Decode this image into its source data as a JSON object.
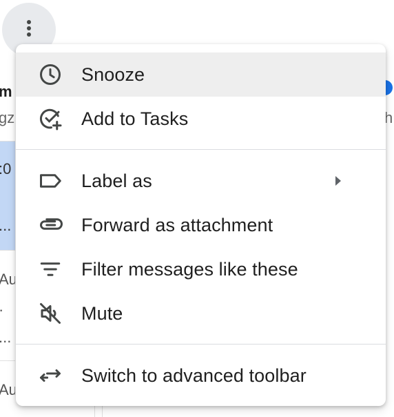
{
  "more_button": {
    "icon": "more-vert-icon"
  },
  "menu": {
    "groups": [
      {
        "items": [
          {
            "label": "Snooze",
            "icon": "clock-icon",
            "hovered": true
          },
          {
            "label": "Add to Tasks",
            "icon": "add-task-icon"
          }
        ]
      },
      {
        "items": [
          {
            "label": "Label as",
            "icon": "label-icon",
            "has_submenu": true
          },
          {
            "label": "Forward as attachment",
            "icon": "attachment-icon"
          },
          {
            "label": "Filter messages like these",
            "icon": "filter-icon"
          },
          {
            "label": "Mute",
            "icon": "mute-icon"
          }
        ]
      },
      {
        "items": [
          {
            "label": "Switch to advanced toolbar",
            "icon": "swap-arrows-icon"
          }
        ]
      }
    ]
  },
  "background": {
    "rows": [
      {
        "line1": "m",
        "line2": "gze"
      },
      {
        "line1": ":0",
        "line2": "..."
      },
      {
        "line1": "Au",
        "line2": "·",
        "line3": "..."
      },
      {
        "line1": "Au"
      }
    ],
    "right_text": "h"
  },
  "colors": {
    "hover_bg": "#eeeeee",
    "text": "#1f1f1f",
    "icon": "#444746",
    "selected_row": "#c2d7f5",
    "badge": "#1a73e8"
  }
}
